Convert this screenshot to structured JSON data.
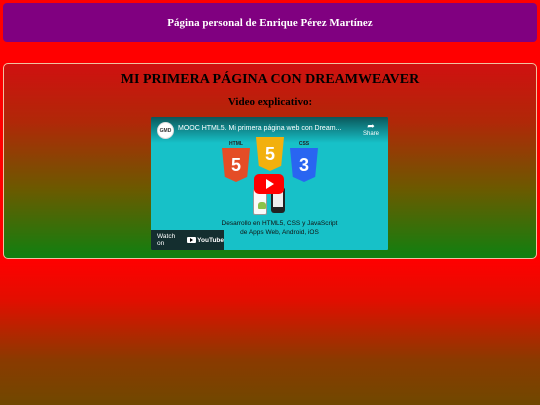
{
  "header": {
    "title": "Página personal de Enrique Pérez Martínez"
  },
  "main": {
    "title": "MI PRIMERA PÁGINA CON DREAMWEAVER",
    "subtitle": "Video explicativo:",
    "video": {
      "channel_badge": "GMD",
      "title": "MOOC HTML5. Mi primera página web con Dream...",
      "share_label": "Share",
      "logos": {
        "html": "HTML",
        "css": "CSS"
      },
      "description_line1": "Desarrollo en HTML5, CSS y JavaScript",
      "description_line2": "de Apps Web, Android, iOS",
      "watch_on": "Watch on",
      "youtube": "YouTube"
    }
  },
  "colors": {
    "header_bg": "#800080",
    "page_bg": "#ff0000",
    "youtube_red": "#ff0000",
    "video_bg": "#17c1c8"
  },
  "icons": [
    "share-icon",
    "play-icon",
    "youtube-icon",
    "html5-icon",
    "css3-icon"
  ]
}
